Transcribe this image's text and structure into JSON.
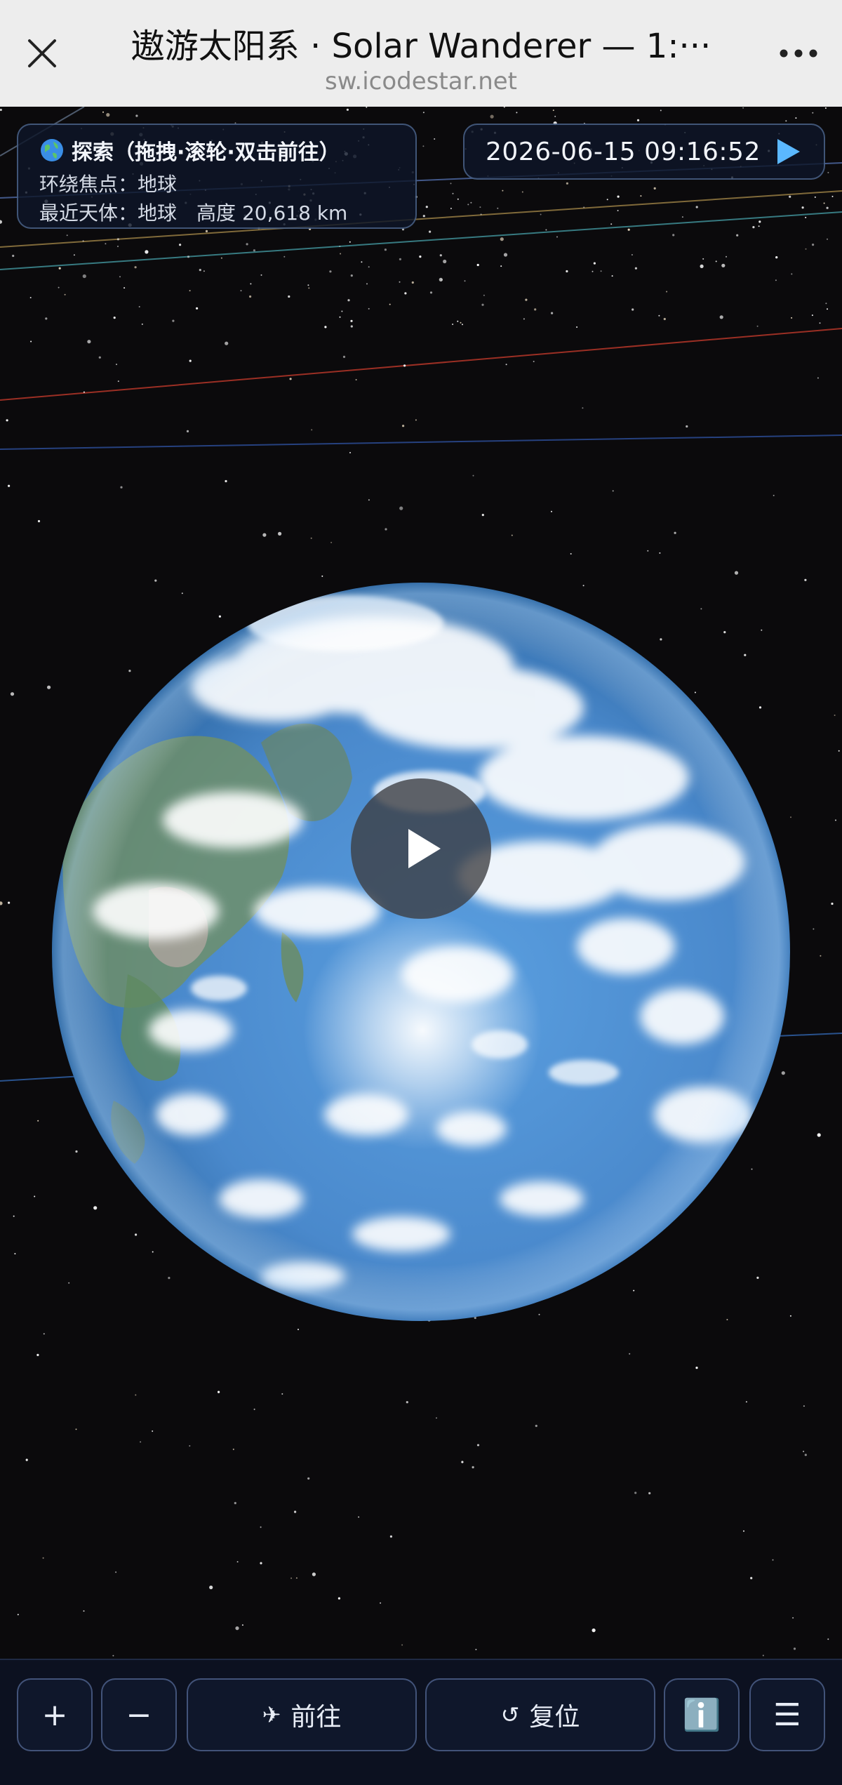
{
  "window": {
    "title": "遨游太阳系 · Solar Wanderer — 1:···",
    "url": "sw.icodestar.net"
  },
  "info": {
    "title": "探索（拖拽·滚轮·双击前往）",
    "orbit_label": "环绕焦点：",
    "orbit_value": "地球",
    "nearest_label": "最近天体：",
    "nearest_value": "地球",
    "altitude_label": "高度",
    "altitude_value": "20,618 km"
  },
  "time": {
    "datetime": "2026-06-15 09:16:52"
  },
  "toolbar": {
    "zoom_in": "+",
    "zoom_out": "−",
    "goto_icon": "✈",
    "goto_label": "前往",
    "reset_icon": "↺",
    "reset_label": "复位",
    "info_label": "ℹ️",
    "menu_label": "☰"
  },
  "icons": {
    "close": "close-icon",
    "more": "more-icon",
    "globe": "globe-icon",
    "play": "play-icon"
  },
  "colors": {
    "accent": "#5bb8ff",
    "panel_bg": "#0e1628",
    "ocean": "#4f93d6"
  }
}
